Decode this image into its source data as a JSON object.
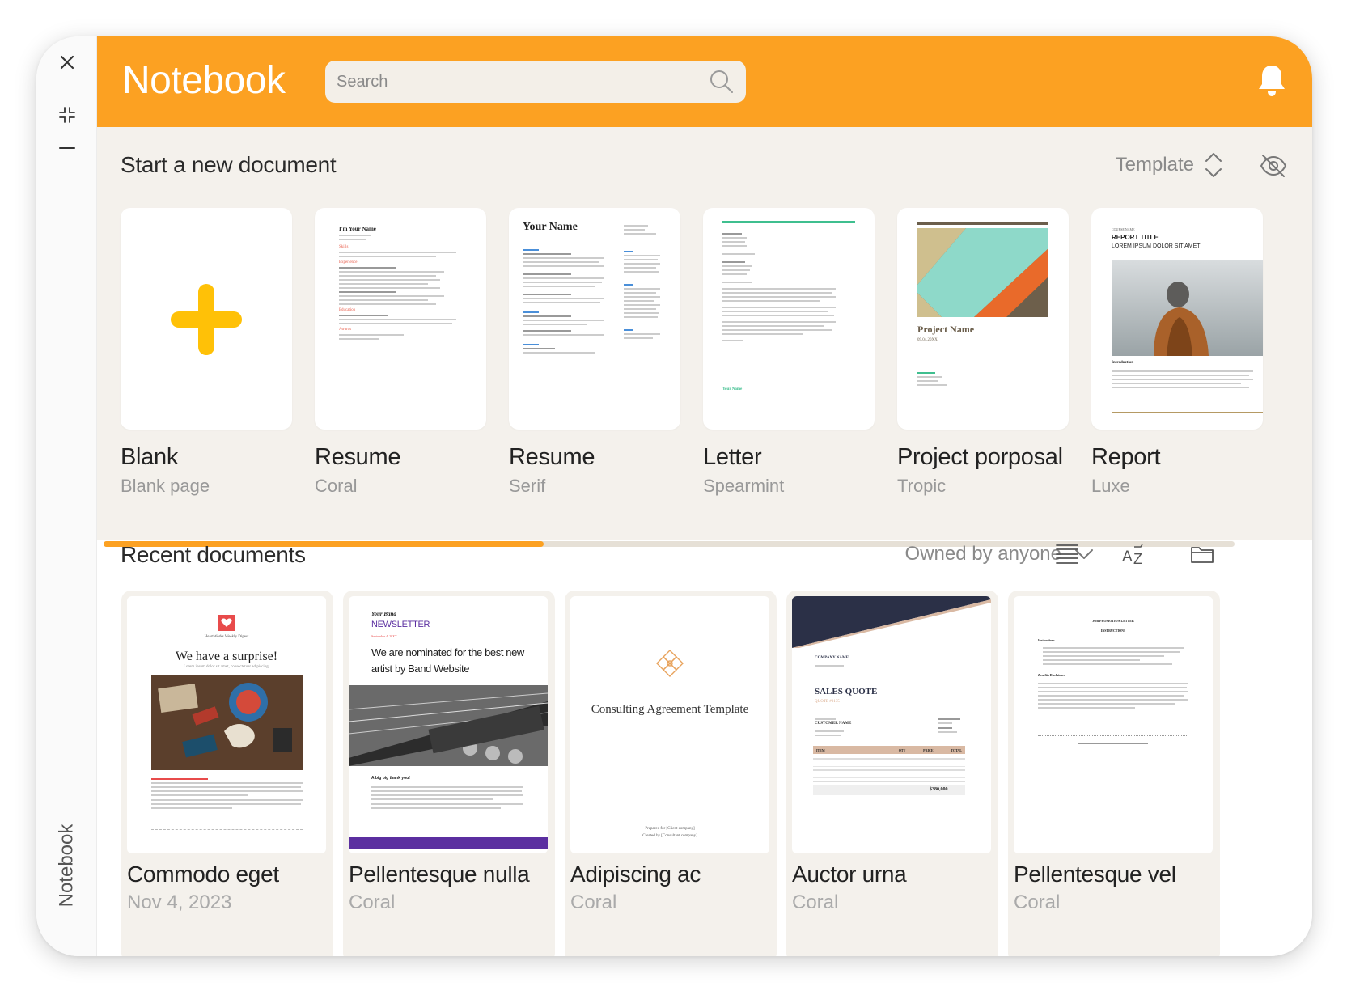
{
  "app": {
    "title": "Notebook",
    "rail_label": "Notebook"
  },
  "search": {
    "placeholder": "Search"
  },
  "new_document": {
    "title": "Start a new document",
    "template_label": "Template",
    "templates": [
      {
        "name": "Blank",
        "style": "Blank page"
      },
      {
        "name": "Resume",
        "style": "Coral"
      },
      {
        "name": "Resume",
        "style": "Serif"
      },
      {
        "name": "Letter",
        "style": "Spearmint"
      },
      {
        "name": "Project porposal",
        "style": "Tropic"
      },
      {
        "name": "Report",
        "style": "Luxe"
      }
    ],
    "previews": {
      "resume_coral": {
        "heading": "I'm Your Name",
        "sections": [
          "Skills",
          "Experience",
          "Education",
          "Awards"
        ]
      },
      "resume_serif": {
        "heading": "Your Name"
      },
      "letter_spearmint": {
        "signature": "Your Name"
      },
      "project_tropic": {
        "heading": "Project Name",
        "date": "09.04.20XX"
      },
      "report_luxe": {
        "kicker": "COURSE NAME",
        "title": "REPORT TITLE",
        "subtitle": "LOREM IPSUM DOLOR SIT AMET",
        "section": "Introduction"
      }
    }
  },
  "recent": {
    "title": "Recent documents",
    "owner_filter": "Owned by anyone",
    "documents": [
      {
        "name": "Commodo eget",
        "meta": "Nov 4, 2023"
      },
      {
        "name": "Pellentesque nulla",
        "meta": "Coral"
      },
      {
        "name": "Adipiscing ac",
        "meta": "Coral"
      },
      {
        "name": "Auctor urna",
        "meta": "Coral"
      },
      {
        "name": "Pellentesque vel",
        "meta": "Coral"
      }
    ],
    "previews": {
      "digest": {
        "brand": "HeartWorks Weekly Digest",
        "headline": "We have a surprise!",
        "tagline": "Lorem ipsum dolor sit amet, consectetuer adipiscing."
      },
      "newsletter": {
        "band": "Your Band",
        "title": "NEWSLETTER",
        "date": "September 4, 20XX",
        "headline": "We are nominated for the best new artist by Band Website",
        "thanks": "A big big thank you!"
      },
      "consulting": {
        "title": "Consulting Agreement Template",
        "prepared_for": "Prepared for [Client company]",
        "created_by": "Created by [Consultant company]"
      },
      "quote": {
        "company": "COMPANY NAME",
        "title": "SALES QUOTE",
        "number": "QUOTE #0135",
        "customer": "CUSTOMER NAME",
        "columns": [
          "ITEM",
          "QTY",
          "PRICE",
          "TOTAL"
        ],
        "total": "$380,000"
      },
      "letter": {
        "title": "JOB PROMOTION LETTER",
        "subtitle": "INSTRUCTIONS",
        "section1": "Instructions",
        "section2": "Zenefits Disclaimer"
      }
    }
  },
  "colors": {
    "accent": "#fca122",
    "panel": "#f4f1ec",
    "plus_icon": "#ffc107"
  }
}
